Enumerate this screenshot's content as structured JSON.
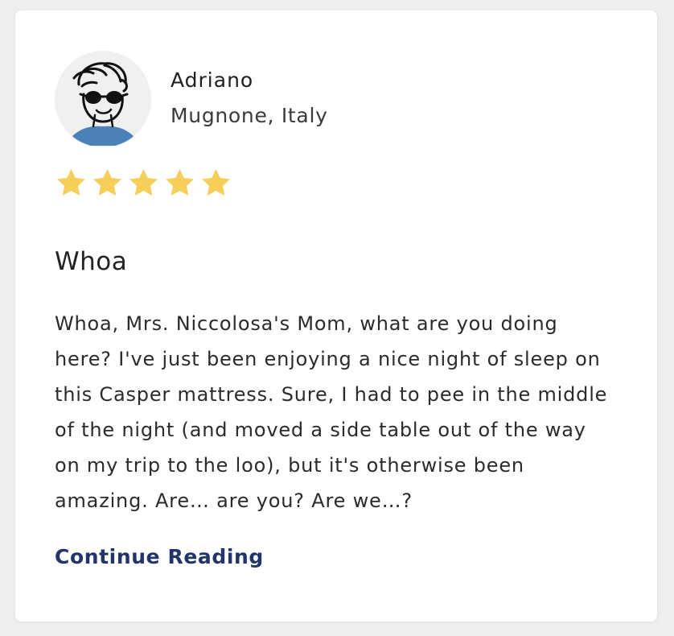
{
  "review": {
    "reviewer_name": "Adriano",
    "reviewer_location": "Mugnone, Italy",
    "rating": 5,
    "rating_max": 5,
    "title": "Whoa",
    "body_lines": [
      "Whoa, Mrs. Niccolosa's Mom, what are you doing",
      "here? I've just been enjoying a nice night of sleep on",
      "this Casper mattress. Sure, I had to pee in the middle",
      "of the night (and moved a side table out of the way",
      "on my trip to the loo), but it's otherwise been",
      "amazing. Are… are you? Are we…?"
    ],
    "continue_label": "Continue Reading"
  },
  "icons": {
    "avatar": "cartoon-avatar-with-sunglasses",
    "star": "star-icon"
  },
  "colors": {
    "star_fill": "#f6cf5a",
    "link": "#22356a",
    "avatar_shirt": "#4a82b8",
    "avatar_bg": "#f0f0f0"
  }
}
